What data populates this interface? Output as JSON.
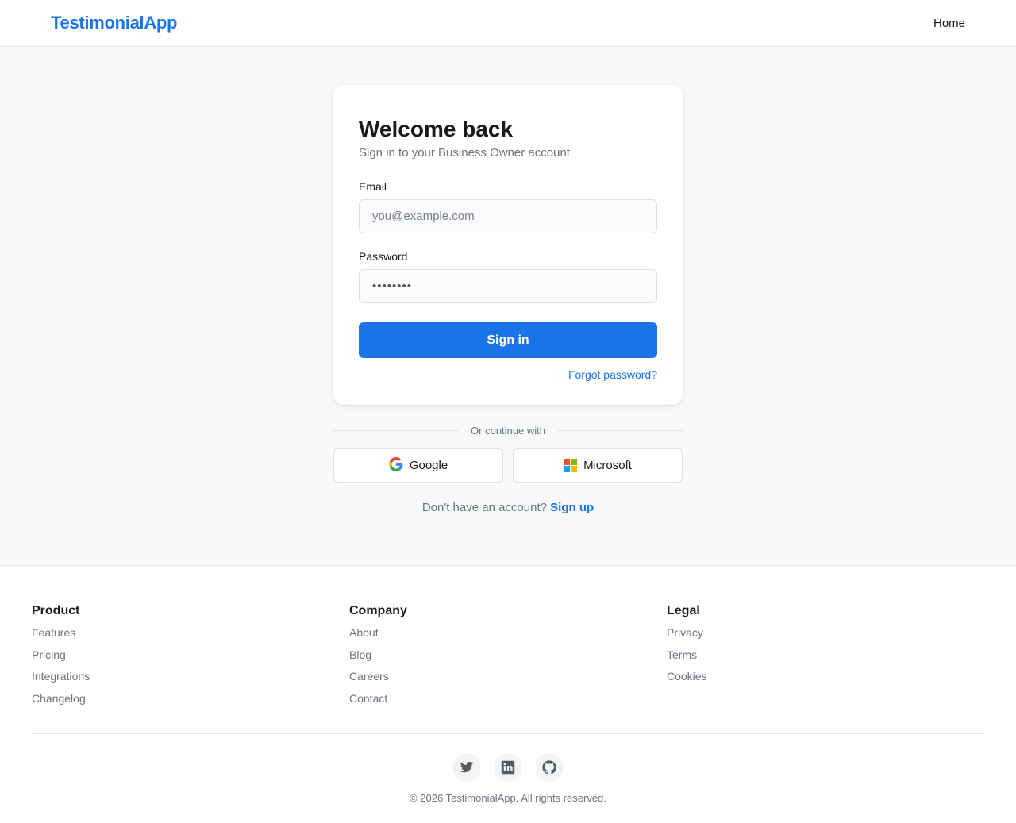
{
  "header": {
    "brand": "TestimonialApp",
    "nav_home": "Home"
  },
  "login": {
    "title": "Welcome back",
    "subtitle": "Sign in to your Business Owner account",
    "email_label": "Email",
    "email_placeholder": "you@example.com",
    "email_value": "",
    "password_label": "Password",
    "password_value": "••••••••",
    "signin_label": "Sign in",
    "forgot_label": "Forgot password?"
  },
  "oauth": {
    "divider_text": "Or continue with",
    "google_label": "Google",
    "google_icon": "google-g-icon",
    "microsoft_label": "Microsoft",
    "microsoft_icon": "microsoft-logo-icon"
  },
  "signup": {
    "prompt": "Don't have an account?",
    "link": "Sign up"
  },
  "footer": {
    "columns": [
      {
        "heading": "Product",
        "links": [
          "Features",
          "Pricing",
          "Integrations",
          "Changelog"
        ]
      },
      {
        "heading": "Company",
        "links": [
          "About",
          "Blog",
          "Careers",
          "Contact"
        ]
      },
      {
        "heading": "Legal",
        "links": [
          "Privacy",
          "Terms",
          "Cookies"
        ]
      }
    ],
    "socials": [
      "twitter-icon",
      "linkedin-icon",
      "github-icon"
    ],
    "copyright": "© 2026 TestimonialApp. All rights reserved."
  },
  "colors": {
    "accent": "#1a73e8",
    "page_bg": "#f8f9fb",
    "muted_text": "#6b7280"
  }
}
